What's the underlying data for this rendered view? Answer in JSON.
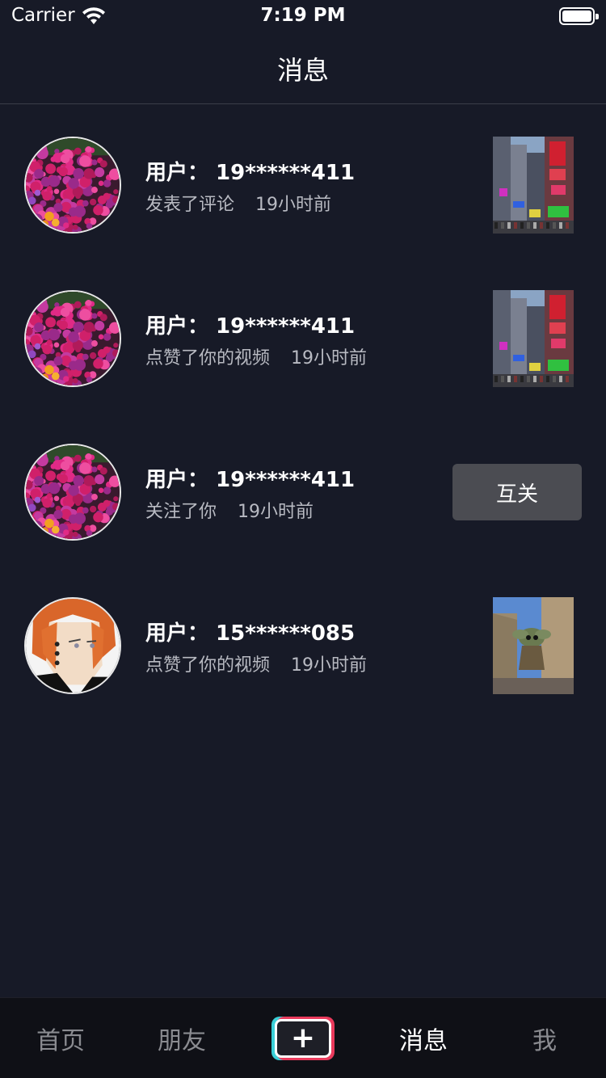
{
  "status_bar": {
    "carrier": "Carrier",
    "time": "7:19 PM"
  },
  "nav": {
    "title": "消息"
  },
  "messages": [
    {
      "user": "用户：  19******411",
      "action": "发表了评论",
      "time": "19小时前",
      "avatar": "flowers",
      "thumbnail": "city-street",
      "follow_label": ""
    },
    {
      "user": "用户：  19******411",
      "action": "点赞了你的视频",
      "time": "19小时前",
      "avatar": "flowers",
      "thumbnail": "city-street",
      "follow_label": ""
    },
    {
      "user": "用户：  19******411",
      "action": "关注了你",
      "time": "19小时前",
      "avatar": "flowers",
      "thumbnail": "",
      "follow_label": "互关"
    },
    {
      "user": "用户：  15******085",
      "action": "点赞了你的视频",
      "time": "19小时前",
      "avatar": "anime-character",
      "thumbnail": "parade-balloon",
      "follow_label": ""
    }
  ],
  "tabs": [
    {
      "label": "首页",
      "active": false
    },
    {
      "label": "朋友",
      "active": false
    },
    {
      "label": "消息",
      "active": true
    },
    {
      "label": "我",
      "active": false
    }
  ],
  "colors": {
    "background": "#171a27",
    "tab_bar": "#0f1016",
    "follow_button": "#4b4c52",
    "plus_cyan": "#3ad0d8",
    "plus_red": "#ea3a5c"
  }
}
